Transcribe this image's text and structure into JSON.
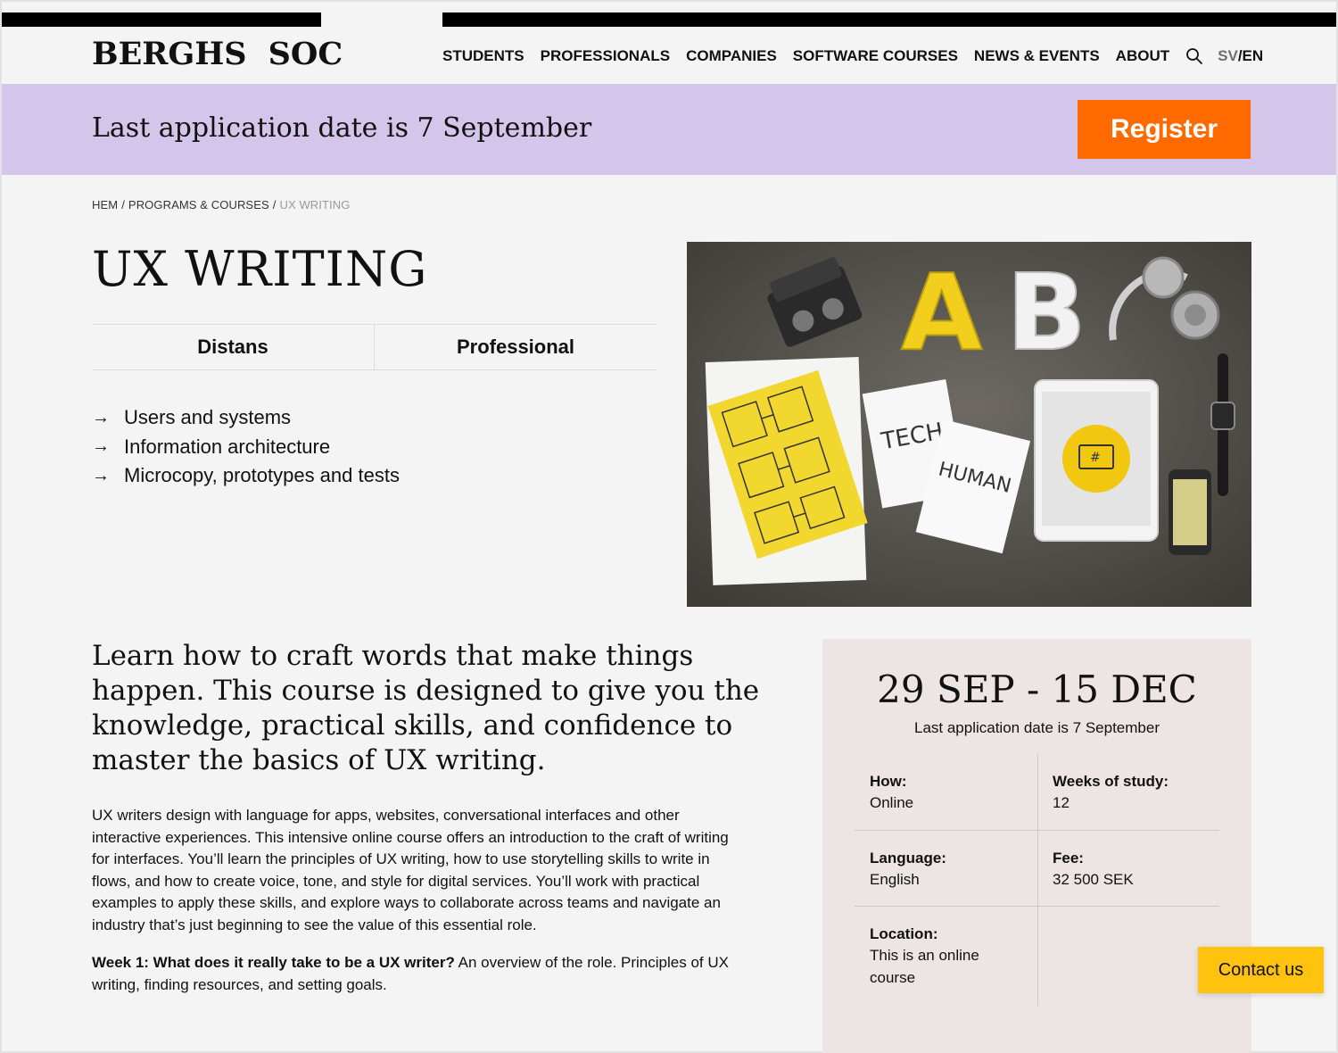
{
  "header": {
    "logo_part1": "BERGHS",
    "logo_part2": "SOC",
    "nav": [
      "STUDENTS",
      "PROFESSIONALS",
      "COMPANIES",
      "SOFTWARE COURSES",
      "NEWS & EVENTS",
      "ABOUT"
    ],
    "lang_sv": "SV",
    "lang_sep": "/",
    "lang_en": "EN"
  },
  "banner": {
    "text": "Last application date is 7 September",
    "register_label": "Register",
    "background": "#d4c5eb",
    "button_color": "#ff6a00"
  },
  "breadcrumb": {
    "items": [
      "HEM",
      "PROGRAMS & COURSES"
    ],
    "separator": "/",
    "current": "UX WRITING"
  },
  "course": {
    "title": "UX WRITING",
    "tags": [
      "Distans",
      "Professional"
    ],
    "bullets": [
      "Users and systems",
      "Information architecture",
      "Microcopy, prototypes and tests"
    ],
    "bullet_arrow": "→"
  },
  "hero": {
    "letters": [
      "A",
      "B"
    ],
    "cards": [
      "TECH",
      "HUMAN"
    ],
    "tablet_symbol": "#"
  },
  "intro": {
    "lead": "Learn how to craft words that make things happen. This course is designed to give you the knowledge, practical skills, and confidence to master the basics of UX writing.",
    "body": "UX writers design with language for apps, websites, conversational interfaces and other interactive experiences. This intensive online course offers an introduction to the craft of writing for interfaces. You’ll learn the principles of UX writing, how to use storytelling skills to write in flows, and how to create voice, tone, and style for digital services. You’ll work with practical examples to apply these skills, and explore ways to collaborate across teams and navigate an industry that’s just beginning to see the value of this essential role.",
    "week_bold": "Week 1: What does it really take to be a UX writer?",
    "week_text": " An overview of the role. Principles of UX writing, finding resources, and setting goals."
  },
  "card": {
    "dates": "29 SEP - 15 DEC",
    "subtitle": "Last application date is 7 September",
    "how_label": "How:",
    "how_value": "Online",
    "weeks_label": "Weeks of study:",
    "weeks_value": "12",
    "language_label": "Language:",
    "language_value": "English",
    "fee_label": "Fee:",
    "fee_value": "32 500 SEK",
    "location_label": "Location:",
    "location_value": "This is an online course",
    "background": "#ece5e3"
  },
  "contact": {
    "label": "Contact us",
    "color": "#ffc20e"
  }
}
